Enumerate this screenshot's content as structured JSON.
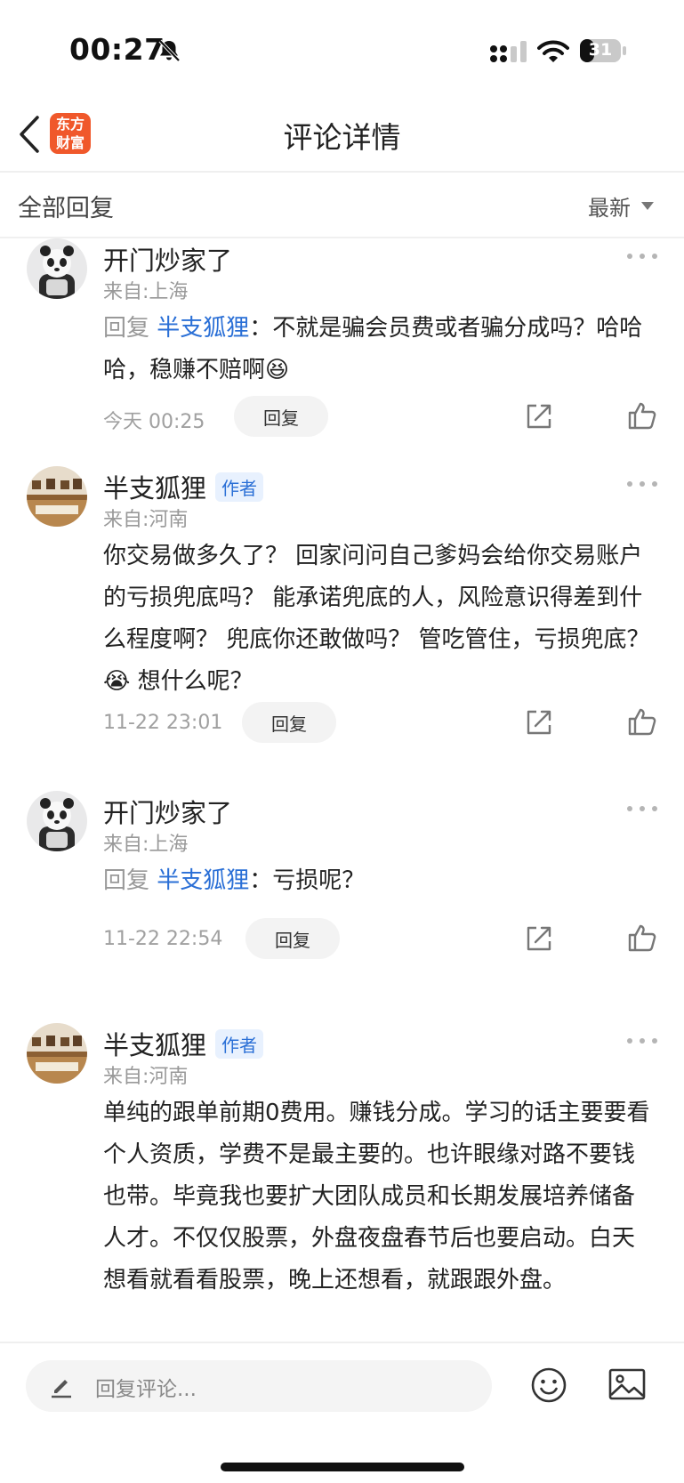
{
  "status_bar": {
    "time": "00:27",
    "battery": "31"
  },
  "nav": {
    "logo_line1": "东方",
    "logo_line2": "财富",
    "title": "评论详情"
  },
  "sort_bar": {
    "title": "全部回复",
    "sort": "最新"
  },
  "comments": [
    {
      "user": "开门炒家了",
      "location": "来自:上海",
      "reply_prefix": "回复 ",
      "mention": "半支狐狸",
      "colon": "：",
      "text": "不就是骗会员费或者骗分成吗？哈哈哈，稳赚不赔啊😆",
      "time": "今天 00:25",
      "reply_label": "回复"
    },
    {
      "user": "半支狐狸",
      "author_tag": "作者",
      "location": "来自:河南",
      "text": "你交易做多久了？ 回家问问自己爹妈会给你交易账户的亏损兜底吗？ 能承诺兜底的人，风险意识得差到什么程度啊？ 兜底你还敢做吗？ 管吃管住，亏损兜底？😭 想什么呢？",
      "time": "11-22 23:01",
      "reply_label": "回复"
    },
    {
      "user": "开门炒家了",
      "location": "来自:上海",
      "reply_prefix": "回复 ",
      "mention": "半支狐狸",
      "colon": "：",
      "text": "亏损呢？",
      "time": "11-22 22:54",
      "reply_label": "回复"
    },
    {
      "user": "半支狐狸",
      "author_tag": "作者",
      "location": "来自:河南",
      "text": "单纯的跟单前期0费用。赚钱分成。学习的话主要要看个人资质，学费不是最主要的。也许眼缘对路不要钱也带。毕竟我也要扩大团队成员和长期发展培养储备人才。不仅仅股票，外盘夜盘春节后也要启动。白天想看就看看股票，晚上还想看，就跟跟外盘。"
    }
  ],
  "bottom_bar": {
    "placeholder": "回复评论..."
  },
  "icons": {
    "back": "chevron-left-icon",
    "more": "more-dots-icon",
    "share": "share-icon",
    "like": "thumbs-up-icon",
    "emoji": "emoji-icon",
    "image": "image-icon",
    "pen": "pen-icon"
  },
  "colors": {
    "accent_blue": "#2a6fd6",
    "logo_orange": "#f0582b"
  }
}
